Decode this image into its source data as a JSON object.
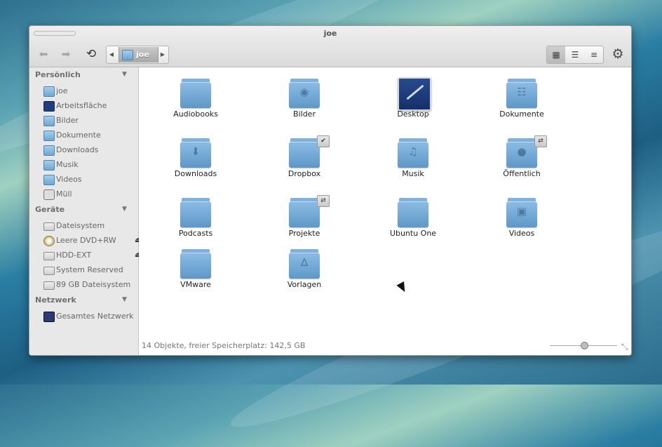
{
  "window": {
    "title": "joe"
  },
  "toolbar": {
    "back_icon": "back-arrow-icon",
    "forward_icon": "forward-arrow-icon",
    "refresh_icon": "refresh-icon",
    "breadcrumb": {
      "current": "joe",
      "icon": "home-folder-icon"
    },
    "views": [
      "icon-view",
      "compact-view",
      "list-view"
    ],
    "active_view": "icon-view",
    "settings_icon": "gear-icon"
  },
  "sidebar": {
    "sections": [
      {
        "title": "Persönlich",
        "items": [
          {
            "label": "joe",
            "icon": "home-folder-icon"
          },
          {
            "label": "Arbeitsfläche",
            "icon": "desktop-icon"
          },
          {
            "label": "Bilder",
            "icon": "pictures-folder-icon"
          },
          {
            "label": "Dokumente",
            "icon": "documents-folder-icon"
          },
          {
            "label": "Downloads",
            "icon": "downloads-folder-icon"
          },
          {
            "label": "Musik",
            "icon": "music-folder-icon"
          },
          {
            "label": "Videos",
            "icon": "videos-folder-icon"
          },
          {
            "label": "Müll",
            "icon": "trash-icon"
          }
        ]
      },
      {
        "title": "Geräte",
        "items": [
          {
            "label": "Dateisystem",
            "icon": "drive-icon"
          },
          {
            "label": "Leere DVD+RW",
            "icon": "disc-icon",
            "eject": true
          },
          {
            "label": "HDD-EXT",
            "icon": "drive-icon",
            "eject": true
          },
          {
            "label": "System Reserved",
            "icon": "drive-icon"
          },
          {
            "label": "89 GB Dateisystem",
            "icon": "drive-icon"
          }
        ]
      },
      {
        "title": "Netzwerk",
        "items": [
          {
            "label": "Gesamtes Netzwerk",
            "icon": "network-icon"
          }
        ]
      }
    ]
  },
  "files": [
    {
      "label": "Audiobooks",
      "icon": "folder-icon"
    },
    {
      "label": "Bilder",
      "icon": "pictures-folder-icon"
    },
    {
      "label": "Desktop",
      "icon": "desktop-icon"
    },
    {
      "label": "Dokumente",
      "icon": "documents-folder-icon"
    },
    {
      "label": "Downloads",
      "icon": "downloads-folder-icon"
    },
    {
      "label": "Dropbox",
      "icon": "folder-icon",
      "emblem": "check-emblem-icon"
    },
    {
      "label": "Musik",
      "icon": "music-folder-icon"
    },
    {
      "label": "Öffentlich",
      "icon": "public-folder-icon",
      "emblem": "shared-emblem-icon"
    },
    {
      "label": "Podcasts",
      "icon": "folder-icon"
    },
    {
      "label": "Projekte",
      "icon": "folder-icon",
      "emblem": "shared-emblem-icon"
    },
    {
      "label": "Ubuntu One",
      "icon": "folder-icon"
    },
    {
      "label": "Videos",
      "icon": "videos-folder-icon"
    },
    {
      "label": "VMware",
      "icon": "folder-icon"
    },
    {
      "label": "Vorlagen",
      "icon": "templates-folder-icon"
    }
  ],
  "status": {
    "text": "14 Objekte, freier Speicherplatz: 142,5 GB",
    "zoom_level": 0.5
  }
}
